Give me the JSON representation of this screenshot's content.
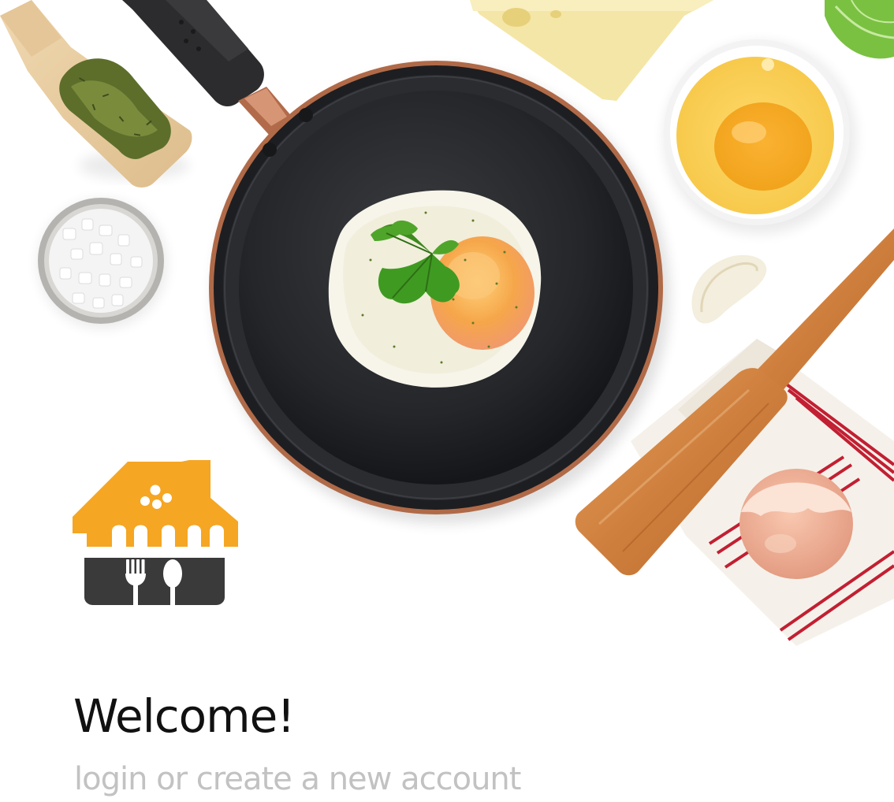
{
  "hero": {
    "scene": "cooking-ingredients-top-view",
    "items": [
      "herb-scoop",
      "sea-salt-bowl",
      "frying-pan",
      "fried-egg",
      "cheese-block",
      "cabbage-leaf",
      "egg-yolk-bowl",
      "garlic-clove",
      "wooden-spatula",
      "kitchen-towel",
      "eggshell"
    ]
  },
  "logo": {
    "icon": "house-with-fork-and-spoon-icon",
    "colors": {
      "roof": "#F5A623",
      "base": "#3A3A3A",
      "utensils": "#FFFFFF"
    }
  },
  "welcome": {
    "title": "Welcome!",
    "subtitle": "login or create a new account"
  },
  "colors": {
    "background": "#FFFFFF",
    "title": "#111111",
    "subtitle": "#C2C2C2",
    "accent": "#F5A623"
  }
}
